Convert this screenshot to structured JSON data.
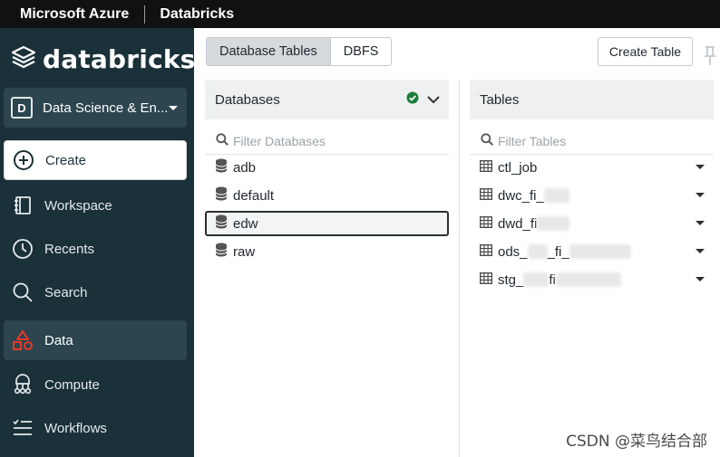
{
  "topbar": {
    "brand_primary": "Microsoft Azure",
    "brand_secondary": "Databricks"
  },
  "sidebar": {
    "logo_text": "databricks",
    "workspace": {
      "badge": "D",
      "label": "Data Science & En..."
    },
    "items": [
      {
        "label": "Create",
        "icon": "plus-circle-icon"
      },
      {
        "label": "Workspace",
        "icon": "notebook-icon"
      },
      {
        "label": "Recents",
        "icon": "clock-icon"
      },
      {
        "label": "Search",
        "icon": "search-icon"
      },
      {
        "label": "Data",
        "icon": "shapes-icon"
      },
      {
        "label": "Compute",
        "icon": "cluster-icon"
      },
      {
        "label": "Workflows",
        "icon": "workflows-icon"
      }
    ]
  },
  "main": {
    "tabs": [
      {
        "label": "Database Tables"
      },
      {
        "label": "DBFS"
      }
    ],
    "create_table_label": "Create Table",
    "databases": {
      "header": "Databases",
      "filter_placeholder": "Filter Databases",
      "items": [
        "adb",
        "default",
        "edw",
        "raw"
      ]
    },
    "tables": {
      "header": "Tables",
      "filter_placeholder": "Filter Tables",
      "items": [
        "ctl_job",
        "dwc_fi_",
        "dwd_fi",
        "ods_",
        "stg_"
      ]
    }
  },
  "watermark": "CSDN @菜鸟结合部",
  "colors": {
    "sidebar_bg": "#1b3139",
    "accent_green": "#1a7f37",
    "data_icon_red": "#ff3621"
  }
}
